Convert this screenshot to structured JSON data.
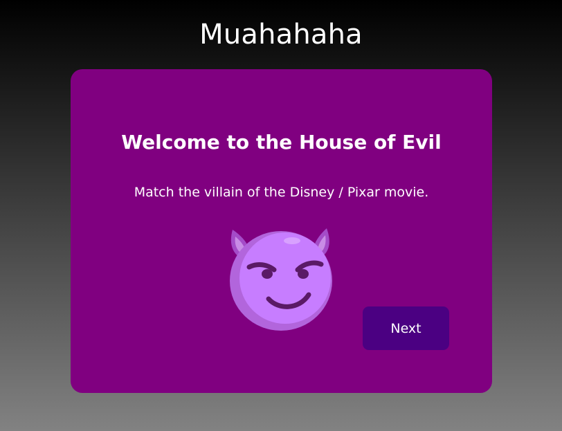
{
  "header": {
    "title": "Muahahaha"
  },
  "card": {
    "heading": "Welcome to the House of Evil",
    "instructions": "Match the villain of the Disney / Pixar movie.",
    "image_icon": "smiling-devil-icon",
    "next_label": "Next"
  },
  "colors": {
    "card_background": "#800080",
    "button_background": "#4b0082",
    "text": "#ffffff",
    "emoji_face": "#c77dff"
  }
}
